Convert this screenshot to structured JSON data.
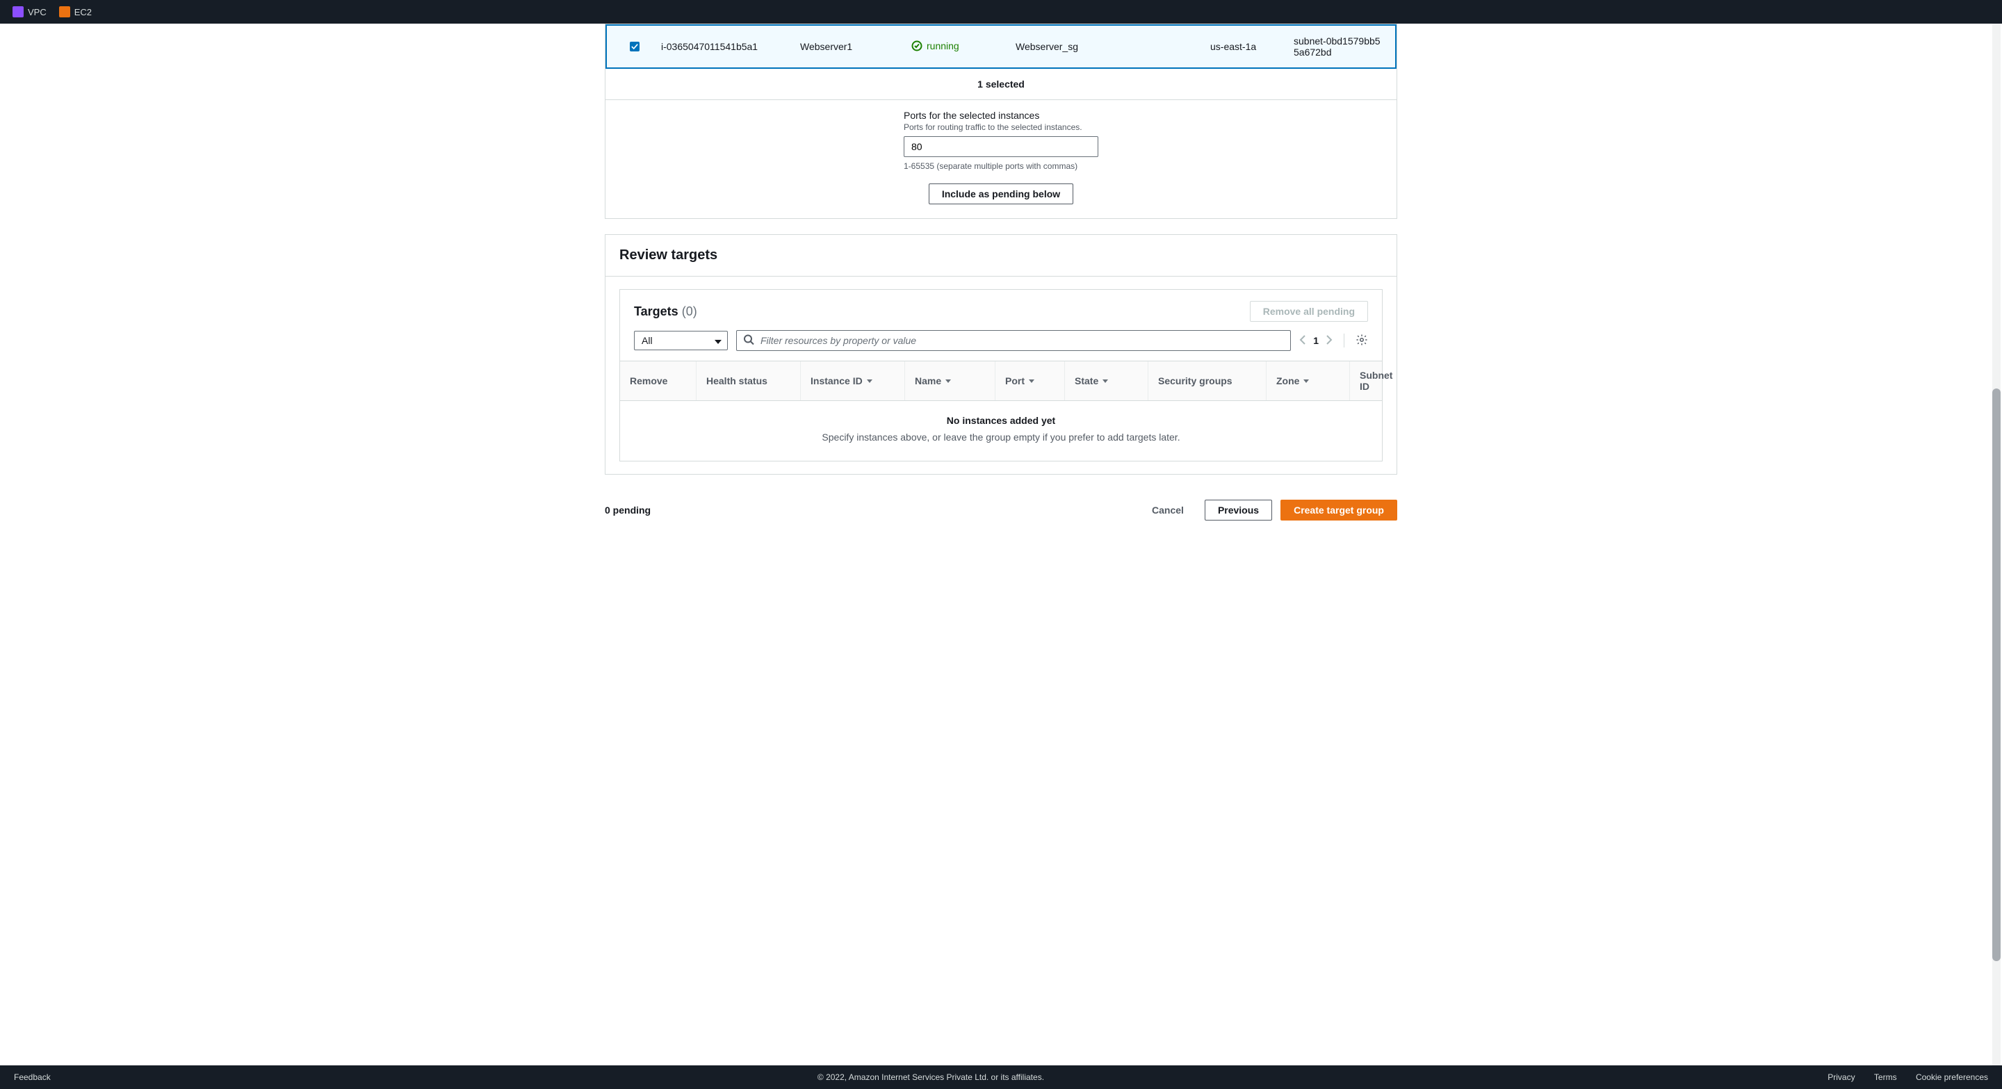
{
  "topnav": {
    "links": [
      {
        "label": "VPC",
        "icon": "vpc"
      },
      {
        "label": "EC2",
        "icon": "ec2"
      }
    ]
  },
  "instance_table": {
    "selected_row": {
      "checked": true,
      "instance_id": "i-0365047011541b5a1",
      "name": "Webserver1",
      "state": "running",
      "security_group": "Webserver_sg",
      "zone": "us-east-1a",
      "subnet": "subnet-0bd1579bb55a672bd"
    },
    "selected_count_text": "1 selected",
    "ports": {
      "label": "Ports for the selected instances",
      "subtext": "Ports for routing traffic to the selected instances.",
      "value": "80",
      "helper": "1-65535 (separate multiple ports with commas)"
    },
    "include_button": "Include as pending below"
  },
  "review": {
    "header": "Review targets",
    "targets_title": "Targets",
    "targets_count_text": "(0)",
    "remove_all_label": "Remove all pending",
    "filter_select_value": "All",
    "filter_placeholder": "Filter resources by property or value",
    "page_number": "1",
    "columns": [
      "Remove",
      "Health status",
      "Instance ID",
      "Name",
      "Port",
      "State",
      "Security groups",
      "Zone",
      "Subnet ID"
    ],
    "empty_title": "No instances added yet",
    "empty_subtitle": "Specify instances above, or leave the group empty if you prefer to add targets later."
  },
  "footer": {
    "pending_text": "0 pending",
    "cancel": "Cancel",
    "previous": "Previous",
    "create": "Create target group"
  },
  "bottom": {
    "feedback": "Feedback",
    "copyright": "© 2022, Amazon Internet Services Private Ltd. or its affiliates.",
    "privacy": "Privacy",
    "terms": "Terms",
    "cookies": "Cookie preferences"
  }
}
